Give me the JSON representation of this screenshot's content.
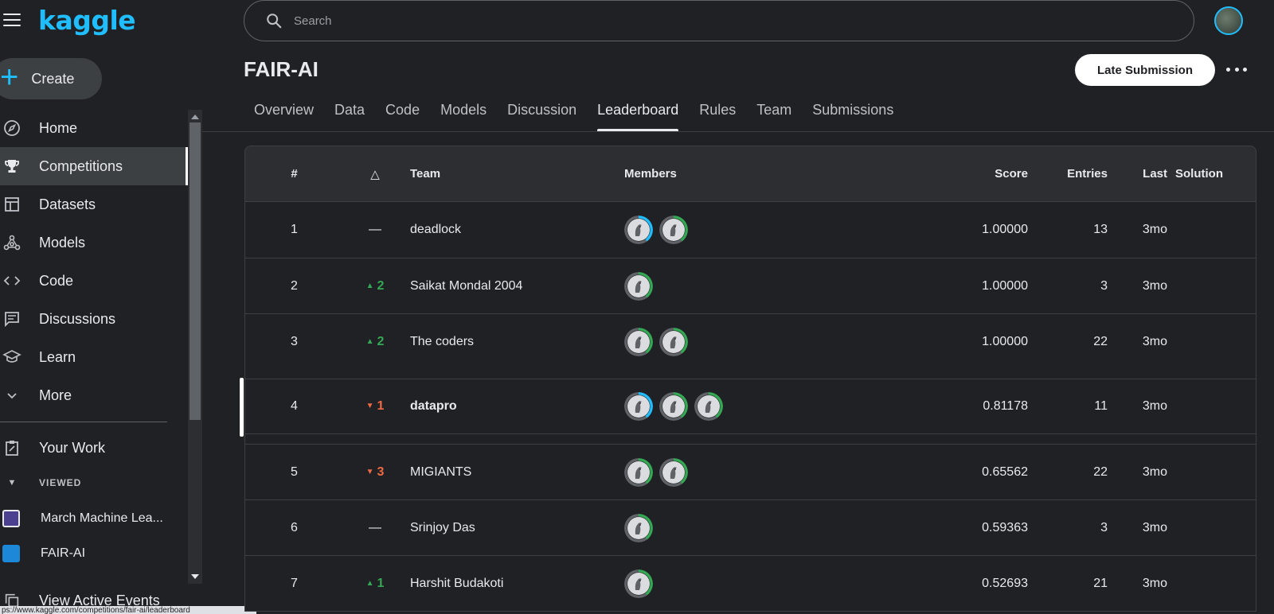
{
  "app": {
    "logo": "kaggle"
  },
  "search": {
    "placeholder": "Search"
  },
  "sidebar": {
    "create_label": "Create",
    "items": [
      {
        "label": "Home",
        "icon": "compass-icon"
      },
      {
        "label": "Competitions",
        "icon": "trophy-icon",
        "active": true
      },
      {
        "label": "Datasets",
        "icon": "table-icon"
      },
      {
        "label": "Models",
        "icon": "models-icon"
      },
      {
        "label": "Code",
        "icon": "code-icon"
      },
      {
        "label": "Discussions",
        "icon": "discussion-icon"
      },
      {
        "label": "Learn",
        "icon": "graduation-cap-icon"
      },
      {
        "label": "More",
        "icon": "chevron-down-icon"
      }
    ],
    "your_work": "Your Work",
    "viewed_header": "VIEWED",
    "recent": [
      {
        "label": "March Machine Lea...",
        "color": "#6a5acd"
      },
      {
        "label": "FAIR-AI",
        "color": "#1e88d8"
      }
    ],
    "active_events": "View Active Events"
  },
  "status_bar_url": "ps://www.kaggle.com/competitions/fair-ai/leaderboard",
  "competition": {
    "title": "FAIR-AI",
    "late_submission_label": "Late Submission",
    "tabs": [
      "Overview",
      "Data",
      "Code",
      "Models",
      "Discussion",
      "Leaderboard",
      "Rules",
      "Team",
      "Submissions"
    ],
    "active_tab": "Leaderboard"
  },
  "leaderboard": {
    "headers": {
      "rank": "#",
      "delta": "△",
      "team": "Team",
      "members": "Members",
      "score": "Score",
      "entries": "Entries",
      "last": "Last",
      "solution": "Solution"
    },
    "rows": [
      {
        "rank": "1",
        "delta": "—",
        "direction": "none",
        "team": "deadlock",
        "members": 2,
        "score": "1.00000",
        "entries": "13",
        "last": "3mo"
      },
      {
        "rank": "2",
        "delta": "2",
        "direction": "up",
        "team": "Saikat Mondal 2004",
        "members": 1,
        "score": "1.00000",
        "entries": "3",
        "last": "3mo"
      },
      {
        "rank": "3",
        "delta": "2",
        "direction": "up",
        "team": "The coders",
        "members": 2,
        "score": "1.00000",
        "entries": "22",
        "last": "3mo"
      },
      {
        "rank": "4",
        "delta": "1",
        "direction": "down",
        "team": "datapro",
        "members": 3,
        "score": "0.81178",
        "entries": "11",
        "last": "3mo",
        "mine": true
      },
      {
        "rank": "5",
        "delta": "3",
        "direction": "down",
        "team": "MIGIANTS",
        "members": 2,
        "score": "0.65562",
        "entries": "22",
        "last": "3mo"
      },
      {
        "rank": "6",
        "delta": "—",
        "direction": "none",
        "team": "Srinjoy Das",
        "members": 1,
        "score": "0.59363",
        "entries": "3",
        "last": "3mo"
      },
      {
        "rank": "7",
        "delta": "1",
        "direction": "up",
        "team": "Harshit Budakoti",
        "members": 1,
        "score": "0.52693",
        "entries": "21",
        "last": "3mo"
      }
    ]
  },
  "colors": {
    "accent": "#20beff",
    "up": "#34a853",
    "down": "#ee6a44",
    "background": "#202124"
  }
}
